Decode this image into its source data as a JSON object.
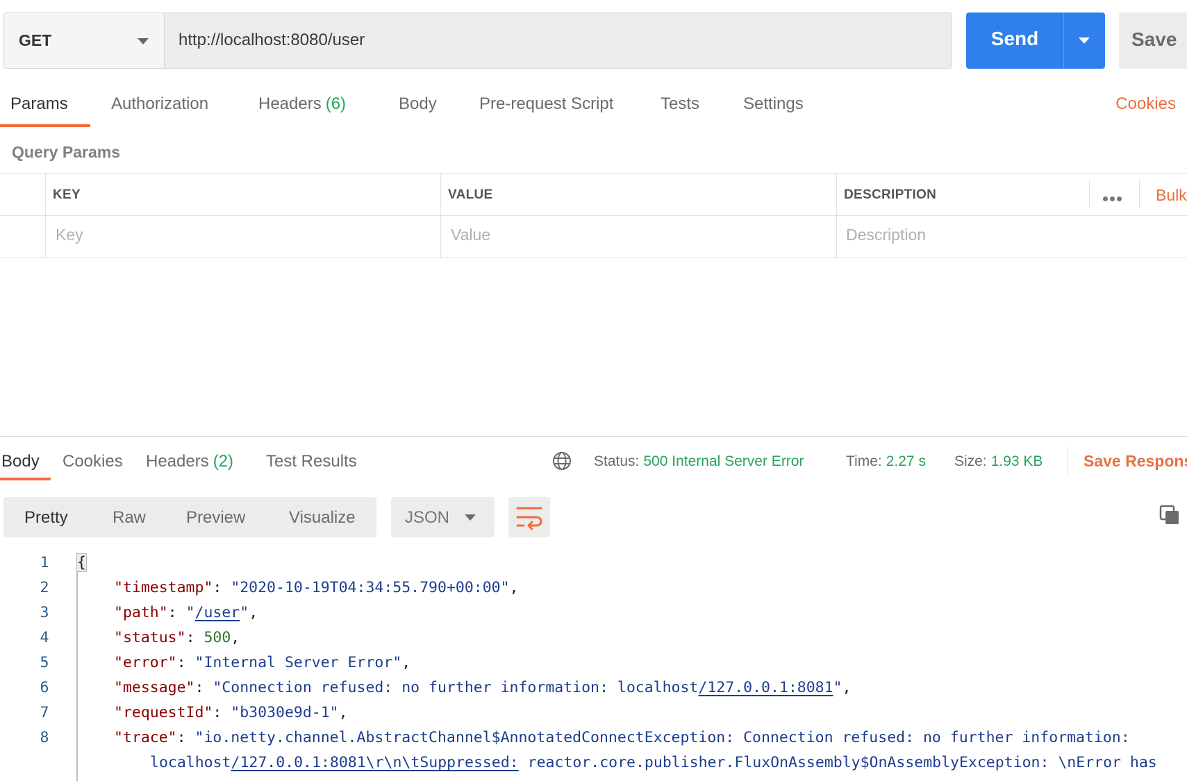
{
  "request": {
    "method": "GET",
    "url": "http://localhost:8080/user",
    "send_label": "Send",
    "save_label": "Save"
  },
  "request_tabs": {
    "params": "Params",
    "authorization": "Authorization",
    "headers": "Headers",
    "headers_count": "(6)",
    "body": "Body",
    "pre_request": "Pre-request Script",
    "tests": "Tests",
    "settings": "Settings",
    "cookies": "Cookies"
  },
  "query_params": {
    "title": "Query Params",
    "columns": {
      "key": "KEY",
      "value": "VALUE",
      "description": "DESCRIPTION"
    },
    "placeholders": {
      "key": "Key",
      "value": "Value",
      "description": "Description"
    },
    "bulk_edit": "Bulk"
  },
  "response": {
    "tabs": {
      "body": "Body",
      "cookies": "Cookies",
      "headers": "Headers",
      "headers_count": "(2)",
      "test_results": "Test Results"
    },
    "status_label": "Status:",
    "status": "500 Internal Server Error",
    "time_label": "Time:",
    "time": "2.27 s",
    "size_label": "Size:",
    "size": "1.93 KB",
    "save_response": "Save Respons",
    "view_modes": [
      "Pretty",
      "Raw",
      "Preview",
      "Visualize"
    ],
    "format": "JSON"
  },
  "code": {
    "line_numbers": [
      "1",
      "2",
      "3",
      "4",
      "5",
      "6",
      "7",
      "8"
    ],
    "open_brace": "{",
    "timestamp_key": "\"timestamp\"",
    "timestamp_val": "\"2020-10-19T04:34:55.790+00:00\"",
    "path_key": "\"path\"",
    "path_q1": "\"",
    "path_val": "/user",
    "path_q2": "\"",
    "status_key": "\"status\"",
    "status_val": "500",
    "error_key": "\"error\"",
    "error_val": "\"Internal Server Error\"",
    "message_key": "\"message\"",
    "message_pre": "\"Connection refused: no further information: localhost",
    "message_link": "/127.0.0.1:8081",
    "message_post": "\"",
    "request_id_key": "\"requestId\"",
    "request_id_val": "\"b3030e9d-1\"",
    "trace_key": "\"trace\"",
    "trace_line1": "\"io.netty.channel.AbstractChannel$AnnotatedConnectException: Connection refused: no further information:",
    "trace_line2_pre": "localhost",
    "trace_line2_link": "/127.0.0.1:8081\\r\\n\\tSuppressed:",
    "trace_line2_post": " reactor.core.publisher.FluxOnAssembly$OnAssemblyException: \\nError has"
  },
  "colors": {
    "accent": "#f26b3a",
    "send": "#2f80ed",
    "success": "#26a55a"
  }
}
